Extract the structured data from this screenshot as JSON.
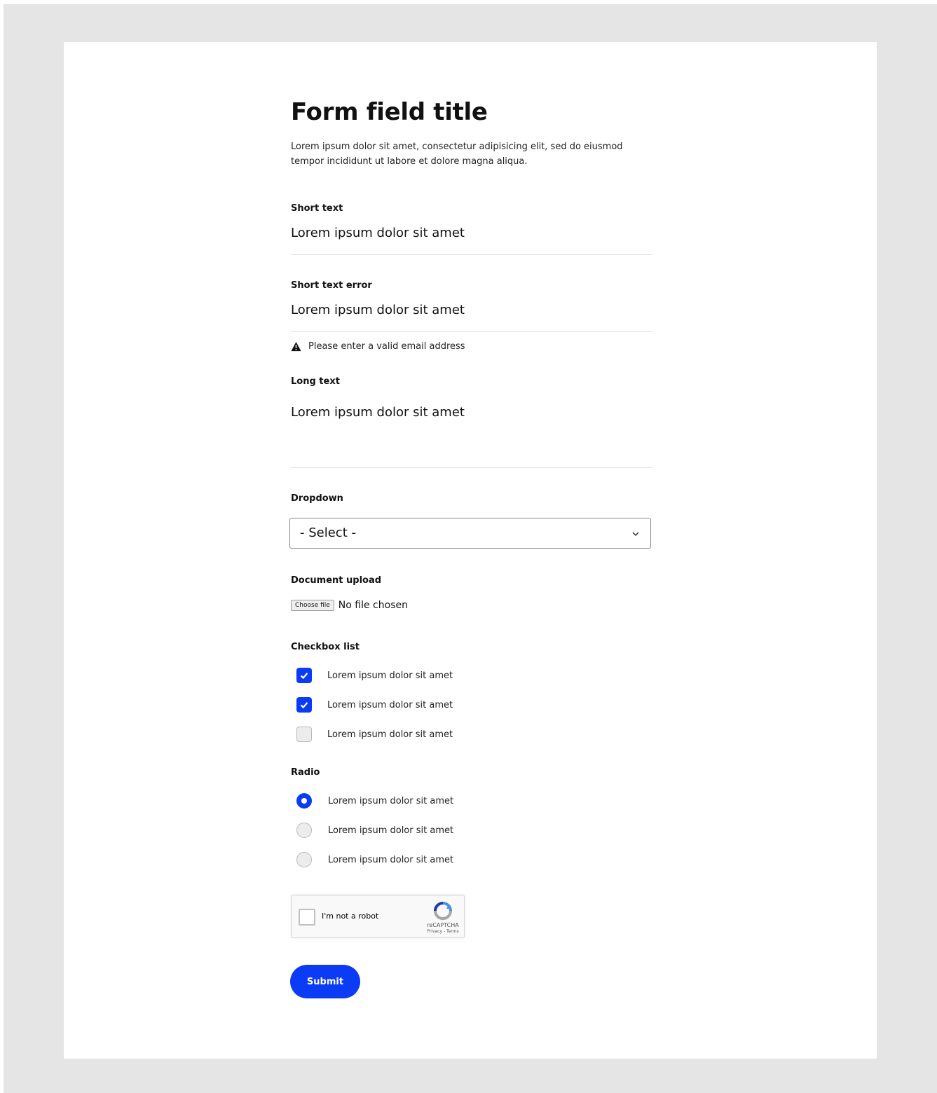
{
  "form": {
    "title": "Form field title",
    "intro": "Lorem ipsum dolor sit amet, consectetur adipisicing elit, sed do eiusmod tempor incididunt ut labore et dolore magna aliqua."
  },
  "short_text": {
    "label": "Short text",
    "value": "Lorem ipsum dolor sit amet"
  },
  "short_text_error": {
    "label": "Short text error",
    "value": "Lorem ipsum dolor sit amet",
    "error_message": "Please enter a valid email address"
  },
  "long_text": {
    "label": "Long text",
    "value": "Lorem ipsum dolor sit amet"
  },
  "dropdown": {
    "label": "Dropdown",
    "selected": "- Select -"
  },
  "document_upload": {
    "label": "Document upload",
    "button_label": "Choose file",
    "status": "No file chosen"
  },
  "checkbox_list": {
    "label": "Checkbox list",
    "items": [
      {
        "label": "Lorem ipsum dolor sit amet",
        "checked": true
      },
      {
        "label": "Lorem ipsum dolor sit amet",
        "checked": true
      },
      {
        "label": "Lorem ipsum dolor sit amet",
        "checked": false
      }
    ]
  },
  "radio": {
    "label": "Radio",
    "items": [
      {
        "label": "Lorem ipsum dolor sit amet",
        "selected": true
      },
      {
        "label": "Lorem ipsum dolor sit amet",
        "selected": false
      },
      {
        "label": "Lorem ipsum dolor sit amet",
        "selected": false
      }
    ]
  },
  "captcha": {
    "label": "I'm not a robot",
    "brand": "reCAPTCHA",
    "links": "Privacy - Terms"
  },
  "submit": {
    "label": "Submit"
  },
  "colors": {
    "accent": "#0b3bf5",
    "background": "#e5e5e5",
    "card": "#ffffff"
  },
  "icons": [
    "warning-icon",
    "chevron-down-icon",
    "check-icon",
    "recaptcha-logo-icon"
  ]
}
